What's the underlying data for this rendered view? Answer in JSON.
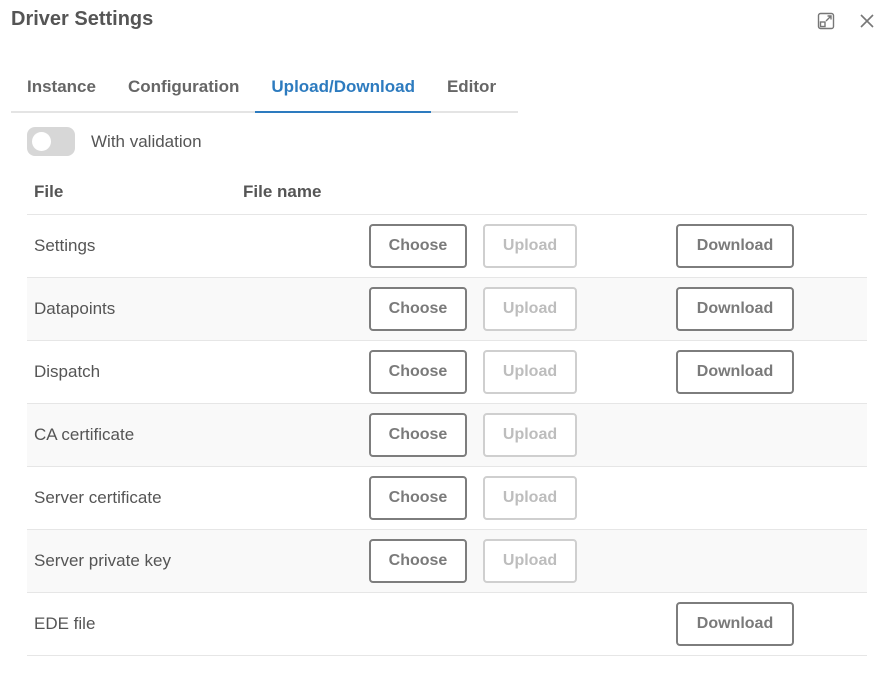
{
  "dialog": {
    "title": "Driver Settings"
  },
  "tabs": [
    {
      "label": "Instance",
      "active": false
    },
    {
      "label": "Configuration",
      "active": false
    },
    {
      "label": "Upload/Download",
      "active": true
    },
    {
      "label": "Editor",
      "active": false
    }
  ],
  "validation": {
    "label": "With validation",
    "enabled": false
  },
  "table": {
    "headers": {
      "file": "File",
      "file_name": "File name"
    },
    "rows": [
      {
        "label": "Settings",
        "choose": "Choose",
        "upload": "Upload",
        "download": "Download"
      },
      {
        "label": "Datapoints",
        "choose": "Choose",
        "upload": "Upload",
        "download": "Download"
      },
      {
        "label": "Dispatch",
        "choose": "Choose",
        "upload": "Upload",
        "download": "Download"
      },
      {
        "label": "CA certificate",
        "choose": "Choose",
        "upload": "Upload"
      },
      {
        "label": "Server certificate",
        "choose": "Choose",
        "upload": "Upload"
      },
      {
        "label": "Server private key",
        "choose": "Choose",
        "upload": "Upload"
      },
      {
        "label": "EDE file",
        "download": "Download"
      }
    ]
  },
  "icons": {
    "expand": "expand-icon",
    "close": "close-icon"
  },
  "colors": {
    "accent": "#2d7bbf",
    "toggle_off": "#d7d7d7"
  }
}
